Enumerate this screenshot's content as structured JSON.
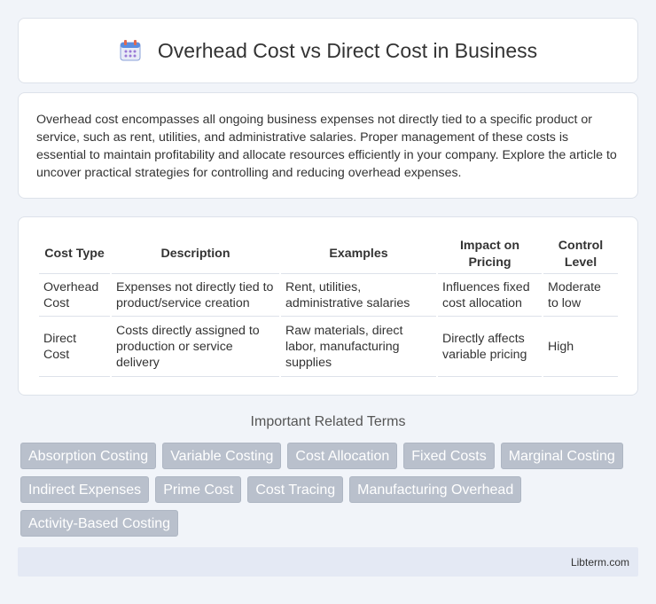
{
  "header": {
    "title": "Overhead Cost vs Direct Cost in Business",
    "icon": "calendar-icon"
  },
  "intro": {
    "text": "Overhead cost encompasses all ongoing business expenses not directly tied to a specific product or service, such as rent, utilities, and administrative salaries. Proper management of these costs is essential to maintain profitability and allocate resources efficiently in your company. Explore the article to uncover practical strategies for controlling and reducing overhead expenses."
  },
  "table": {
    "headers": [
      "Cost Type",
      "Description",
      "Examples",
      "Impact on Pricing",
      "Control Level"
    ],
    "rows": [
      [
        "Overhead Cost",
        "Expenses not directly tied to product/service creation",
        "Rent, utilities, administrative salaries",
        "Influences fixed cost allocation",
        "Moderate to low"
      ],
      [
        "Direct Cost",
        "Costs directly assigned to production or service delivery",
        "Raw materials, direct labor, manufacturing supplies",
        "Directly affects variable pricing",
        "High"
      ]
    ]
  },
  "related": {
    "title": "Important Related Terms",
    "tags": [
      "Absorption Costing",
      "Variable Costing",
      "Cost Allocation",
      "Fixed Costs",
      "Marginal Costing",
      "Indirect Expenses",
      "Prime Cost",
      "Cost Tracing",
      "Manufacturing Overhead",
      "Activity-Based Costing"
    ]
  },
  "footer": {
    "text": "Libterm.com"
  },
  "colors": {
    "background": "#f1f4f9",
    "tag_bg": "#b9c0cc",
    "footer_bg": "#e4e9f4"
  }
}
